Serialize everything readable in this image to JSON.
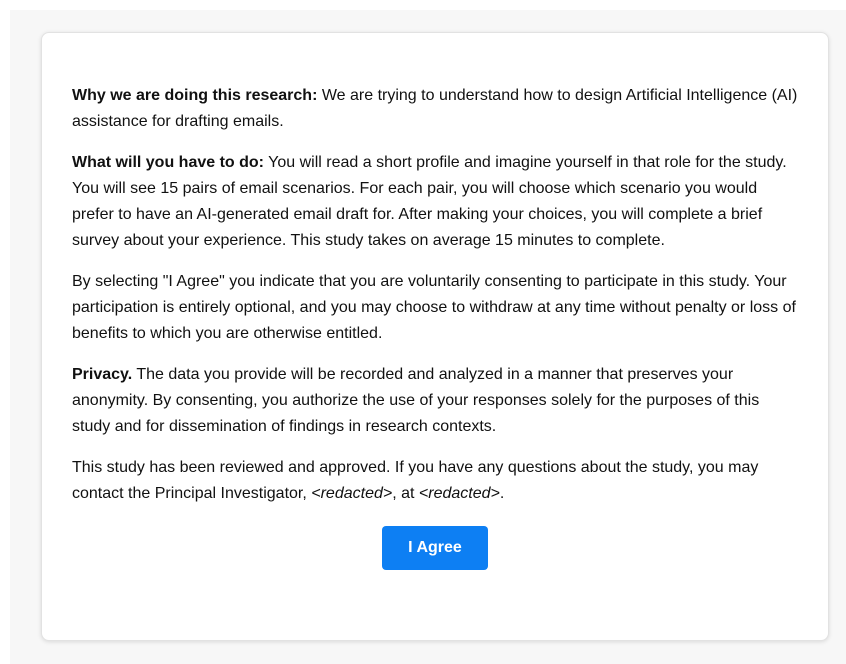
{
  "consent": {
    "why": {
      "heading": "Why we are doing this research:",
      "text": " We are trying to understand how to design Artificial Intelligence (AI) assistance for drafting emails."
    },
    "what": {
      "heading": "What will you have to do:",
      "text": " You will read a short profile and imagine yourself in that role for the study. You will see 15 pairs of email scenarios. For each pair, you will choose which scenario you would prefer to have an AI-generated email draft for. After making your choices, you will complete a brief survey about your experience. This study takes on average 15 minutes to complete."
    },
    "voluntary": {
      "text": "By selecting \"I Agree\" you indicate that you are voluntarily consenting to participate in this study. Your participation is entirely optional, and you may choose to withdraw at any time without penalty or loss of benefits to which you are otherwise entitled."
    },
    "privacy": {
      "heading": "Privacy.",
      "text": " The data you provide will be recorded and analyzed in a manner that preserves your anonymity. By consenting, you authorize the use of your responses solely for the purposes of this study and for dissemination of findings in research contexts."
    },
    "contact": {
      "text_before": "This study has been reviewed and approved. If you have any questions about the study, you may contact the Principal Investigator, ",
      "redacted_name": "<redacted>",
      "text_middle": ", at ",
      "redacted_email": "<redacted>",
      "text_after": "."
    },
    "agree_label": "I Agree"
  },
  "colors": {
    "button": "#0d7ff3",
    "page_background": "#f7f7f7"
  }
}
